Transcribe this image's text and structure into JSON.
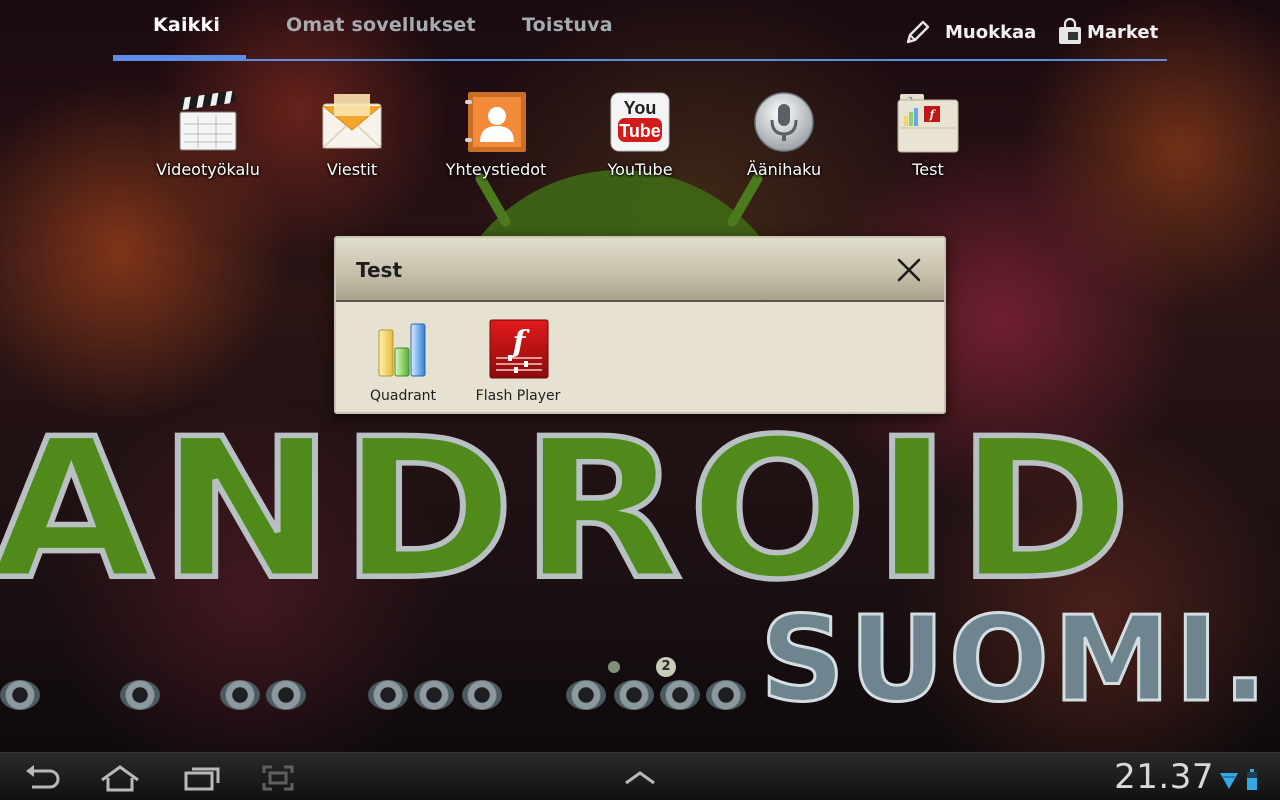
{
  "tabs": [
    {
      "label": "Kaikki",
      "active": true
    },
    {
      "label": "Omat sovellukset",
      "active": false
    },
    {
      "label": "Toistuva",
      "active": false
    }
  ],
  "actions": {
    "edit_label": "Muokkaa",
    "market_label": "Market"
  },
  "apps": [
    {
      "name": "Videotyökalu",
      "icon": "clapperboard-icon"
    },
    {
      "name": "Viestit",
      "icon": "envelope-icon"
    },
    {
      "name": "Yhteystiedot",
      "icon": "contacts-icon"
    },
    {
      "name": "YouTube",
      "icon": "youtube-icon"
    },
    {
      "name": "Äänihaku",
      "icon": "microphone-icon"
    },
    {
      "name": "Test",
      "icon": "folder-icon"
    }
  ],
  "youtube_logo": {
    "you": "You",
    "tube": "Tube"
  },
  "folder_badge": "2",
  "folder_popup": {
    "title": "Test",
    "apps": [
      {
        "name": "Quadrant",
        "icon": "bar-chart-icon"
      },
      {
        "name": "Flash Player",
        "icon": "flash-icon"
      }
    ]
  },
  "wallpaper": {
    "headline": "ANDROID",
    "sub": "SUOMI.FI"
  },
  "page_indicator": {
    "current_page": "2"
  },
  "system_bar": {
    "clock": "21.37",
    "nav_icons": [
      "back-icon",
      "home-icon",
      "recent-apps-icon",
      "screenshot-icon",
      "up-chevron-icon"
    ],
    "status_icons": [
      "wifi-icon",
      "battery-icon"
    ]
  },
  "colors": {
    "accent": "#5d8ee6",
    "folder_bg": "#e6e1d0",
    "android_green": "#4f8a1a"
  }
}
